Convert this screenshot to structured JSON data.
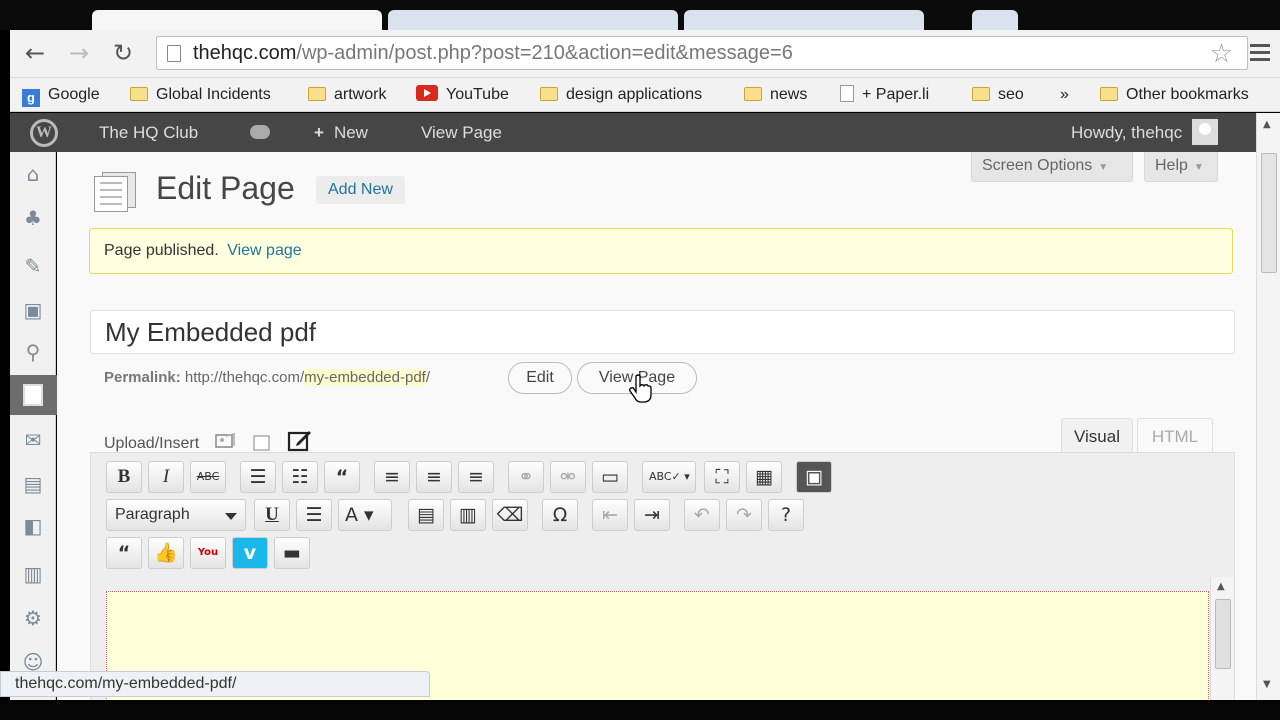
{
  "browser": {
    "url_host": "thehqc.com",
    "url_path": "/wp-admin/post.php?post=210&action=edit&message=6",
    "status_url": "thehqc.com/my-embedded-pdf/"
  },
  "bookmarks": [
    {
      "label": "Google",
      "icon": "google-icon"
    },
    {
      "label": "Global Incidents",
      "icon": "folder-icon"
    },
    {
      "label": "artwork",
      "icon": "folder-icon"
    },
    {
      "label": "YouTube",
      "icon": "youtube-icon"
    },
    {
      "label": "design applications",
      "icon": "folder-icon"
    },
    {
      "label": "news",
      "icon": "folder-icon"
    },
    {
      "label": "+ Paper.li",
      "icon": "document-icon"
    },
    {
      "label": "seo",
      "icon": "folder-icon"
    },
    {
      "label": "»",
      "icon": "overflow-icon"
    },
    {
      "label": "Other bookmarks",
      "icon": "folder-icon"
    }
  ],
  "adminbar": {
    "site_name": "The HQ Club",
    "new_label": "New",
    "view_page": "View Page",
    "howdy": "Howdy, thehqc"
  },
  "screen_options": "Screen Options",
  "help": "Help",
  "page": {
    "heading": "Edit Page",
    "add_new": "Add New",
    "notice_text": "Page published.",
    "notice_link": "View page",
    "post_title": "My Embedded pdf",
    "permalink_label": "Permalink:",
    "permalink_base": "http://thehqc.com/",
    "permalink_slug": "my-embedded-pdf",
    "permalink_trail": "/",
    "edit_button": "Edit",
    "view_button": "View Page",
    "upload_insert": "Upload/Insert",
    "visual_tab": "Visual",
    "html_tab": "HTML",
    "format_select": "Paragraph"
  },
  "colors": {
    "admin_bar": "#464646",
    "notice_bg": "#ffffe0",
    "notice_border": "#e6db55",
    "link": "#21759b"
  }
}
